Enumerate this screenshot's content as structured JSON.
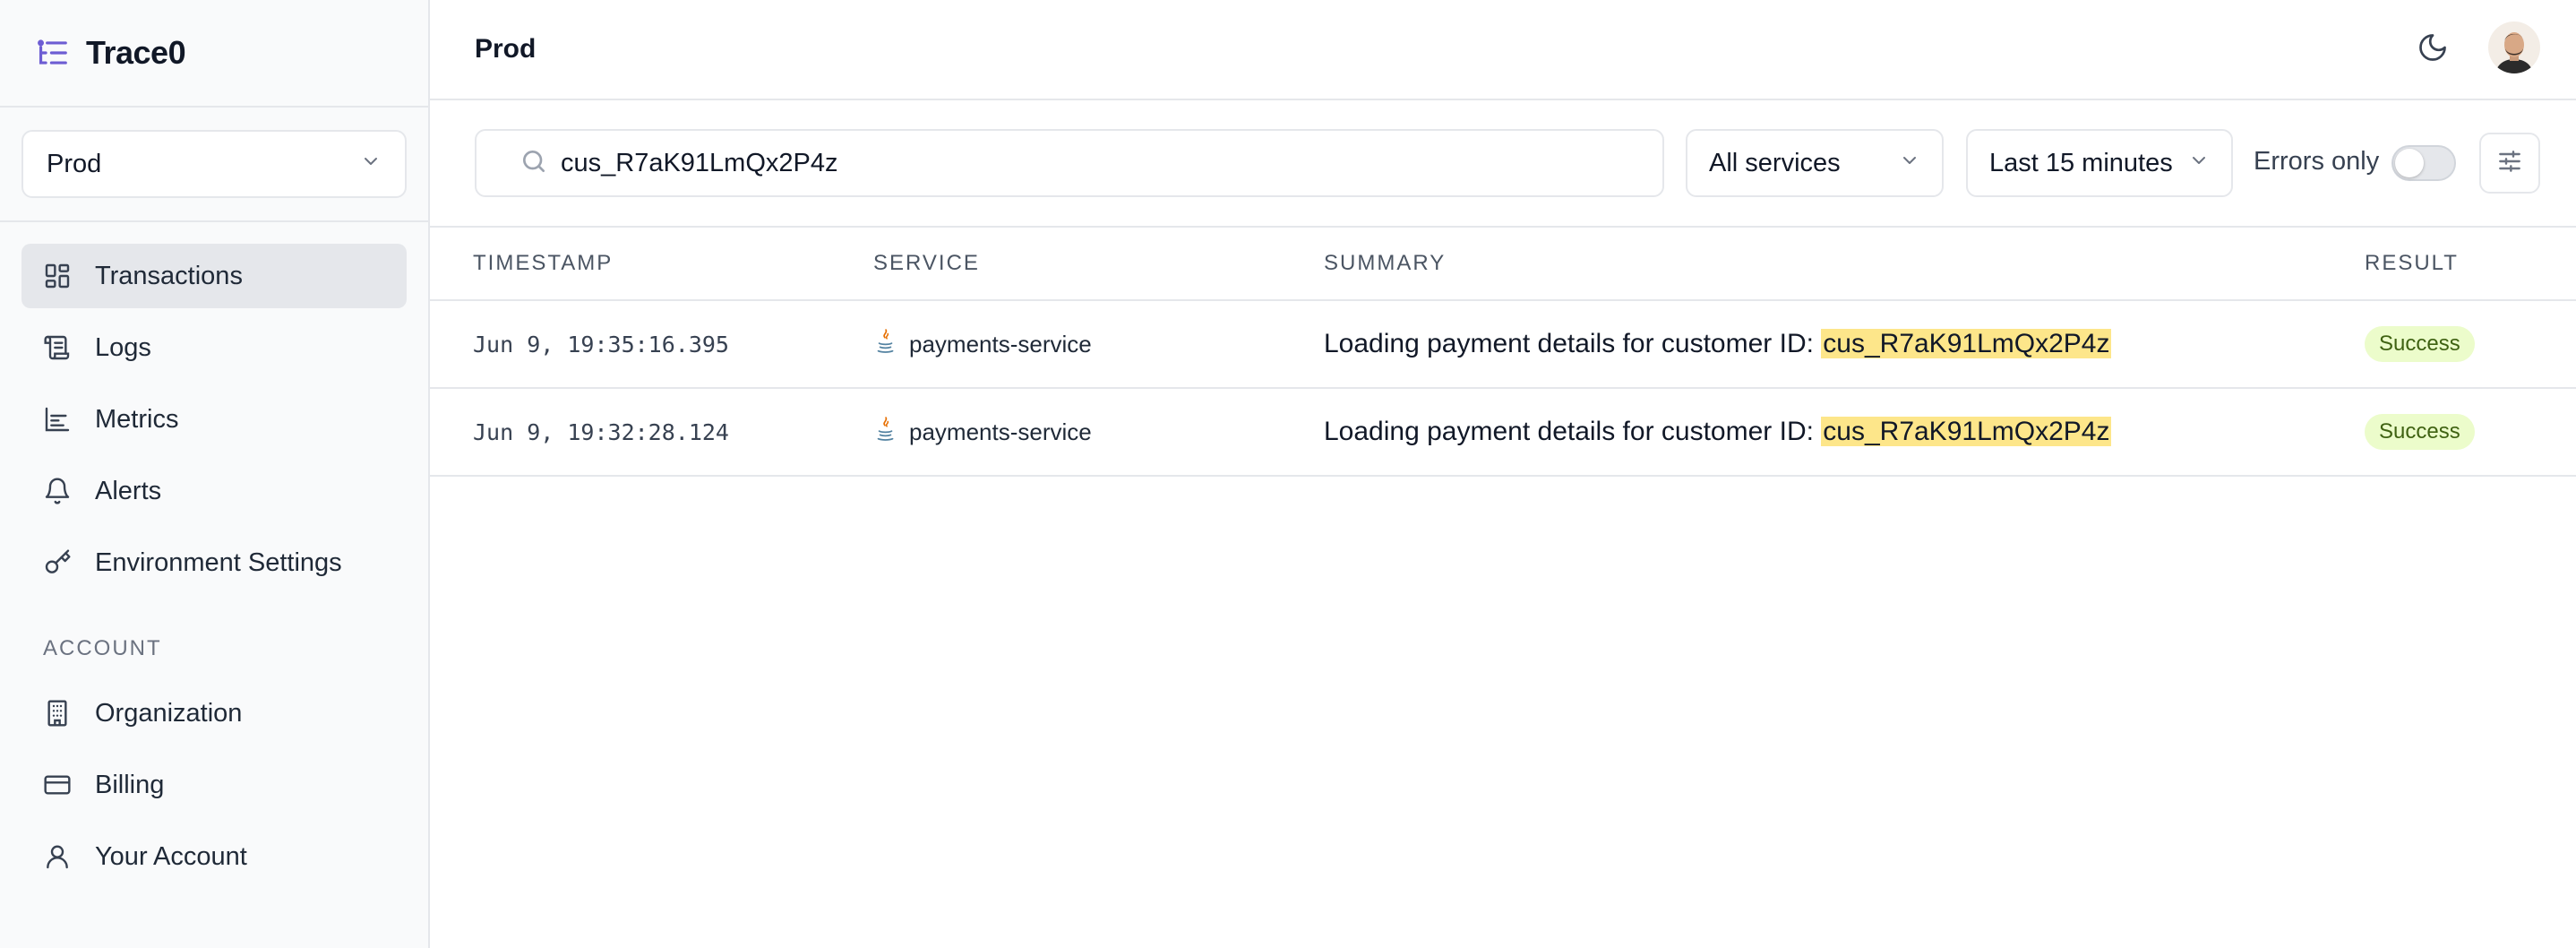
{
  "app": {
    "name": "Trace0"
  },
  "environment": {
    "selected": "Prod"
  },
  "nav": {
    "items": [
      {
        "label": "Transactions",
        "icon": "grid-icon",
        "active": true
      },
      {
        "label": "Logs",
        "icon": "scroll-icon"
      },
      {
        "label": "Metrics",
        "icon": "chart-icon"
      },
      {
        "label": "Alerts",
        "icon": "bell-icon"
      },
      {
        "label": "Environment Settings",
        "icon": "key-icon"
      }
    ],
    "account_section": "ACCOUNT",
    "account_items": [
      {
        "label": "Organization",
        "icon": "building-icon"
      },
      {
        "label": "Billing",
        "icon": "credit-card-icon"
      },
      {
        "label": "Your Account",
        "icon": "user-icon"
      }
    ]
  },
  "header": {
    "title": "Prod"
  },
  "filters": {
    "search_value": "cus_R7aK91LmQx2P4z",
    "services": "All services",
    "time_range": "Last 15 minutes",
    "errors_only_label": "Errors only",
    "errors_only": false
  },
  "table": {
    "columns": {
      "timestamp": "TIMESTAMP",
      "service": "SERVICE",
      "summary": "SUMMARY",
      "result": "RESULT"
    },
    "rows": [
      {
        "timestamp": "Jun 9, 19:35:16.395",
        "service": "payments-service",
        "summary_prefix": "Loading payment details for customer ID: ",
        "summary_highlight": "cus_R7aK91LmQx2P4z",
        "result": "Success"
      },
      {
        "timestamp": "Jun 9, 19:32:28.124",
        "service": "payments-service",
        "summary_prefix": "Loading payment details for customer ID: ",
        "summary_highlight": "cus_R7aK91LmQx2P4z",
        "result": "Success"
      }
    ]
  },
  "colors": {
    "accent": "#6d5dd3",
    "highlight": "#fde68a",
    "success_bg": "#ecfccb",
    "success_text": "#3f6212"
  }
}
